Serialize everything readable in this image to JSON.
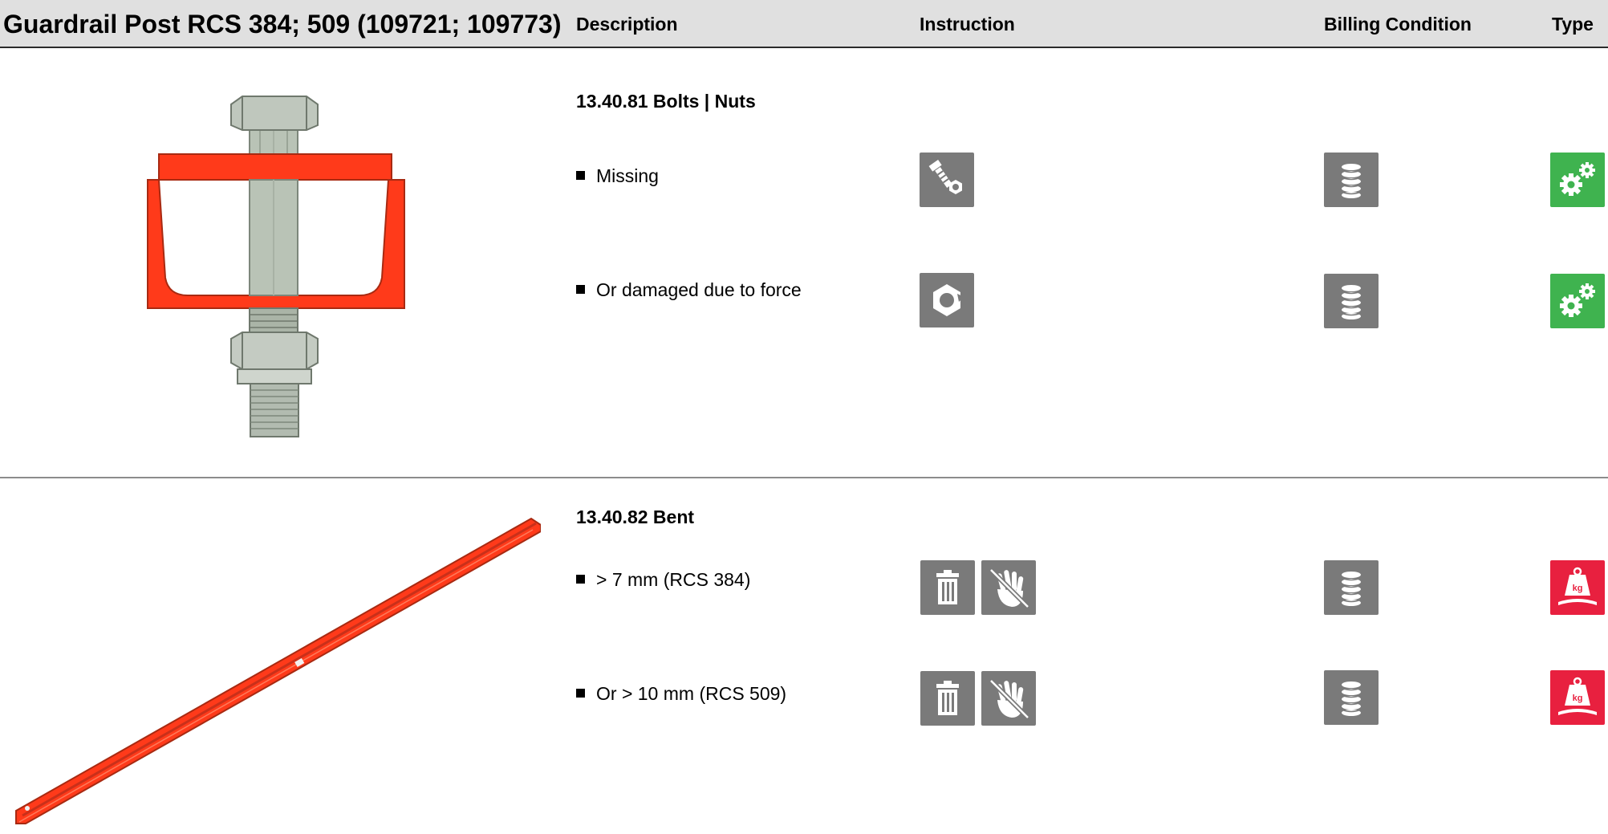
{
  "header": {
    "title": "Guardrail Post RCS 384; 509 (109721; 109773)",
    "col_description": "Description",
    "col_instruction": "Instruction",
    "col_billing": "Billing Condition",
    "col_type": "Type"
  },
  "sections": [
    {
      "title": "13.40.81 Bolts | Nuts",
      "items": [
        {
          "text": "Missing",
          "instruction_icons": [
            "bolt-nut-icon"
          ],
          "billing_icon": "coin-stack-icon",
          "type_icon": "gears-icon",
          "type_color": "#3fb34f"
        },
        {
          "text": "Or damaged due to force",
          "instruction_icons": [
            "damaged-nut-icon"
          ],
          "billing_icon": "coin-stack-icon",
          "type_icon": "gears-icon",
          "type_color": "#3fb34f"
        }
      ]
    },
    {
      "title": "13.40.82 Bent",
      "items": [
        {
          "text": "> 7 mm (RCS 384)",
          "instruction_icons": [
            "trash-icon",
            "no-hand-icon"
          ],
          "billing_icon": "coin-stack-icon",
          "type_icon": "weight-kg-icon",
          "type_color": "#e8203f"
        },
        {
          "text": "Or > 10 mm (RCS 509)",
          "instruction_icons": [
            "trash-icon",
            "no-hand-icon"
          ],
          "billing_icon": "coin-stack-icon",
          "type_icon": "weight-kg-icon",
          "type_color": "#e8203f"
        }
      ]
    }
  ],
  "weight_label": "kg",
  "colors": {
    "header_bg": "#e0e0e0",
    "icon_gray": "#7a7a7a",
    "repair_green": "#3fb34f",
    "scrap_red": "#e8203f",
    "part_orange": "#ff3a1a"
  }
}
